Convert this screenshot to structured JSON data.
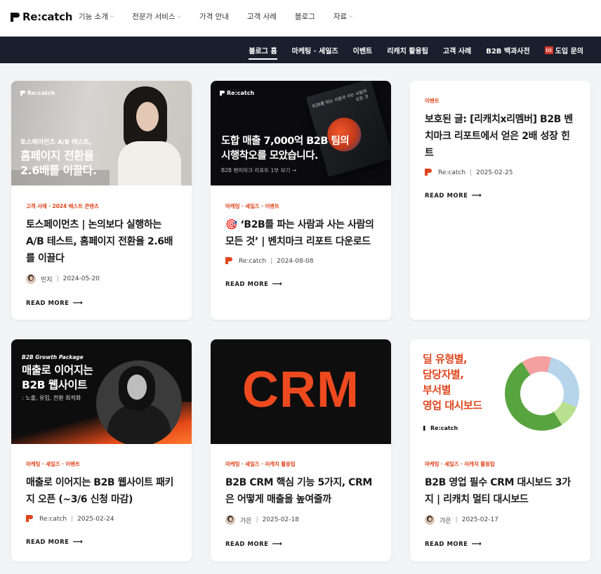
{
  "header": {
    "logo_text": "Re:catch",
    "nav": [
      {
        "label": "기능 소개",
        "dropdown": true
      },
      {
        "label": "전문가 서비스",
        "dropdown": true
      },
      {
        "label": "가격 안내",
        "dropdown": false
      },
      {
        "label": "고객 사례",
        "dropdown": false
      },
      {
        "label": "블로그",
        "dropdown": false
      },
      {
        "label": "자료",
        "dropdown": true
      }
    ]
  },
  "subnav": {
    "items": [
      "블로그 홈",
      "마케팅 · 세일즈",
      "이벤트",
      "리캐치 활용팁",
      "고객 사례",
      "B2B 백과사전"
    ],
    "cta": "도입 문의",
    "active_index": 0
  },
  "read_more": "READ MORE",
  "posts": [
    {
      "category": "고객 사례 · 2024 베스트 콘텐츠",
      "title": "토스페이먼츠 | 논의보다 실행하는 A/B 테스트, 홈페이지 전환율 2.6배를 이끌다",
      "author": "민지",
      "date": "2024-05-20",
      "thumb": {
        "brand": "Re:catch",
        "small": "토스페이먼츠 A/B 테스트,",
        "big": [
          "홈페이지 전환율",
          "2.6배를 이끌다."
        ]
      }
    },
    {
      "category": "마케팅 · 세일즈 · 이벤트",
      "title": "🎯 ‘B2B를 파는 사람과 사는 사람의 모든 것’ | 벤치마크 리포트 다운로드",
      "author": "Re:catch",
      "date": "2024-08-08",
      "thumb": {
        "brand": "Re:catch",
        "big": [
          "도합 매출 7,000억 B2B 팀의",
          "시행착오를 모았습니다."
        ],
        "sub": "B2B 벤치마크 리포트 1부 보기 →",
        "book": "B2B를 파는 사람과 사는 사람의 모든 것"
      }
    },
    {
      "category": "이벤트",
      "title": "보호된 글: [리캐치x리멤버] B2B 벤치마크 리포트에서 얻은 2배 성장 힌트",
      "author": "Re:catch",
      "date": "2025-02-25"
    },
    {
      "category": "마케팅 · 세일즈 · 이벤트",
      "title": "매출로 이어지는 B2B 웹사이트 패키지 오픈 (~3/6 신청 마감)",
      "author": "Re:catch",
      "date": "2025-02-24",
      "thumb": {
        "tag": "B2B Growth Package",
        "big": [
          "매출로 이어지는",
          "B2B 웹사이트"
        ],
        "sub": ": 노출, 유입, 전환 최적화"
      }
    },
    {
      "category": "마케팅 · 세일즈 · 리캐치 활용팁",
      "title": "B2B CRM 핵심 기능 5가지, CRM은 어떻게 매출을 높여줄까",
      "author": "가은",
      "date": "2025-02-18",
      "thumb": {
        "big": "CRM"
      }
    },
    {
      "category": "마케팅 · 세일즈 · 리캐치 활용팁",
      "title": "B2B 영업 필수 CRM 대시보드 3가지 | 리캐치 멀티 대시보드",
      "author": "가은",
      "date": "2025-02-17",
      "thumb": {
        "big": [
          "딜 유형별,",
          "담당자별,",
          "부서별",
          "영업 대시보드"
        ],
        "brand": "Re:catch"
      }
    }
  ],
  "donut_colors": [
    "#b6d4ea",
    "#b9e08f",
    "#58a540",
    "#f4a0a0"
  ],
  "accent_color": "#e0461e",
  "subnav_bg": "#1a1f2e"
}
